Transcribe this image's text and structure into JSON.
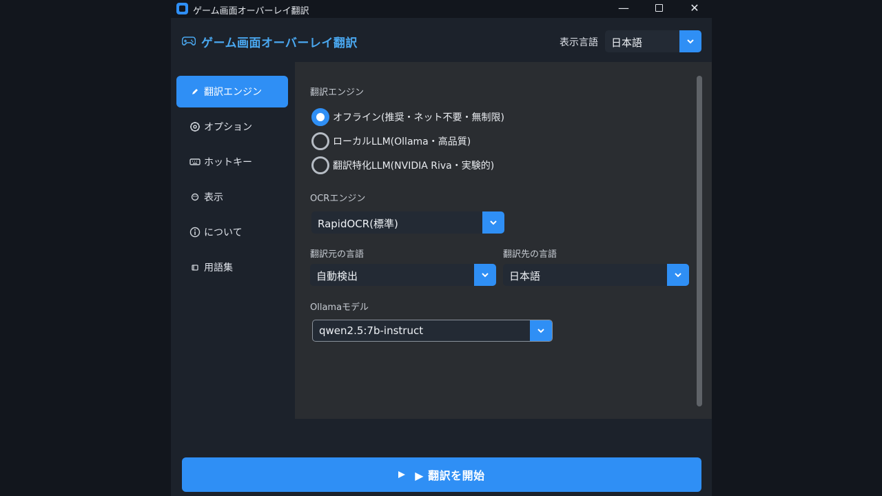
{
  "window": {
    "title": "ゲーム画面オーバーレイ翻訳",
    "minimize_glyph": "—",
    "close_glyph": "✕"
  },
  "header": {
    "title": "ゲーム画面オーバーレイ翻訳",
    "display_language_label": "表示言語",
    "display_language_value": "日本語"
  },
  "sidebar": {
    "items": [
      {
        "label": "翻訳エンジン",
        "icon": "pencil-icon",
        "active": true
      },
      {
        "label": "オプション",
        "icon": "gear-icon",
        "active": false
      },
      {
        "label": "ホットキー",
        "icon": "keyboard-icon",
        "active": false
      },
      {
        "label": "表示",
        "icon": "palette-icon",
        "active": false
      },
      {
        "label": "について",
        "icon": "info-icon",
        "active": false
      },
      {
        "label": "用語集",
        "icon": "book-icon",
        "active": false
      }
    ]
  },
  "engine": {
    "section_label": "翻訳エンジン",
    "options": [
      {
        "label": "オフライン(推奨・ネット不要・無制限)",
        "checked": true
      },
      {
        "label": "ローカルLLM(Ollama・高品質)",
        "checked": false
      },
      {
        "label": "翻訳特化LLM(NVIDIA Riva・実験的)",
        "checked": false
      }
    ]
  },
  "ocr": {
    "section_label": "OCRエンジン",
    "value": "RapidOCR(標準)"
  },
  "source_language": {
    "section_label": "翻訳元の言語",
    "value": "自動検出"
  },
  "target_language": {
    "section_label": "翻訳先の言語",
    "value": "日本語"
  },
  "ollama": {
    "section_label": "Ollamaモデル",
    "value": "qwen2.5:7b-instruct"
  },
  "footer": {
    "start_button_label": "▶ 翻訳を開始"
  },
  "colors": {
    "accent": "#2f8ff5",
    "title_accent": "#4aa8f0",
    "panel_bg": "#2a2d31",
    "window_bg": "#1c222b"
  }
}
